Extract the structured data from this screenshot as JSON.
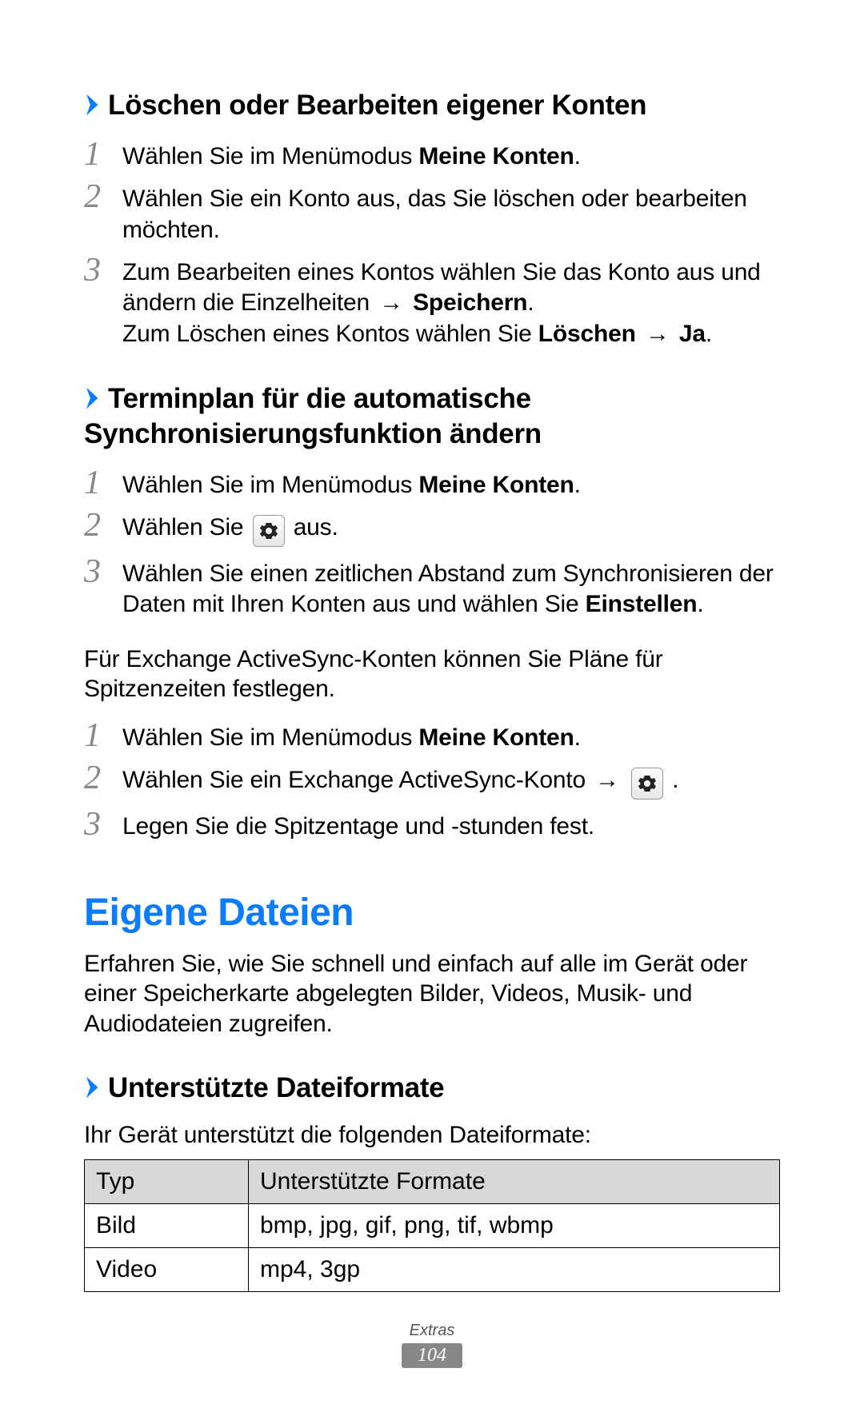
{
  "sec_delete": {
    "heading": "Löschen oder Bearbeiten eigener Konten",
    "steps": {
      "s1_a": "Wählen Sie im Menümodus ",
      "s1_b": "Meine Konten",
      "s1_c": ".",
      "s2": "Wählen Sie ein Konto aus, das Sie löschen oder bearbeiten möchten.",
      "s3_a": "Zum Bearbeiten eines Kontos wählen Sie das Konto aus und ändern die Einzelheiten ",
      "s3_b": "Speichern",
      "s3_c": ".",
      "s3_d": "Zum Löschen eines Kontos wählen Sie ",
      "s3_e": "Löschen",
      "s3_f": "Ja",
      "s3_g": "."
    }
  },
  "sec_sched": {
    "heading": "Terminplan für die automatische Synchronisierungsfunktion ändern",
    "steps_a": {
      "s1_a": "Wählen Sie im Menümodus ",
      "s1_b": "Meine Konten",
      "s1_c": ".",
      "s2_a": "Wählen Sie ",
      "s2_b": " aus.",
      "s3_a": "Wählen Sie einen zeitlichen Abstand zum Synchronisieren der Daten mit Ihren Konten aus und wählen Sie ",
      "s3_b": "Einstellen",
      "s3_c": "."
    },
    "intertext": "Für Exchange ActiveSync-Konten können Sie Pläne für Spitzenzeiten festlegen.",
    "steps_b": {
      "s1_a": "Wählen Sie im Menümodus ",
      "s1_b": "Meine Konten",
      "s1_c": ".",
      "s2_a": "Wählen Sie ein Exchange ActiveSync-Konto ",
      "s2_b": " .",
      "s3": "Legen Sie die Spitzentage und -stunden fest."
    }
  },
  "sec_files": {
    "heading": "Eigene Dateien",
    "intro": "Erfahren Sie, wie Sie schnell und einfach auf alle im Gerät oder einer Speicherkarte abgelegten Bilder, Videos, Musik- und Audiodateien zugreifen."
  },
  "sec_formats": {
    "heading": "Unterstützte Dateiformate",
    "intro": "Ihr Gerät unterstützt die folgenden Dateiformate:",
    "table": {
      "h1": "Typ",
      "h2": "Unterstützte Formate",
      "r1c1": "Bild",
      "r1c2": "bmp, jpg, gif, png, tif, wbmp",
      "r2c1": "Video",
      "r2c2": "mp4, 3gp"
    }
  },
  "footer": {
    "section": "Extras",
    "page": "104"
  },
  "glyphs": {
    "arrow": "→"
  },
  "nums": {
    "n1": "1",
    "n2": "2",
    "n3": "3"
  }
}
